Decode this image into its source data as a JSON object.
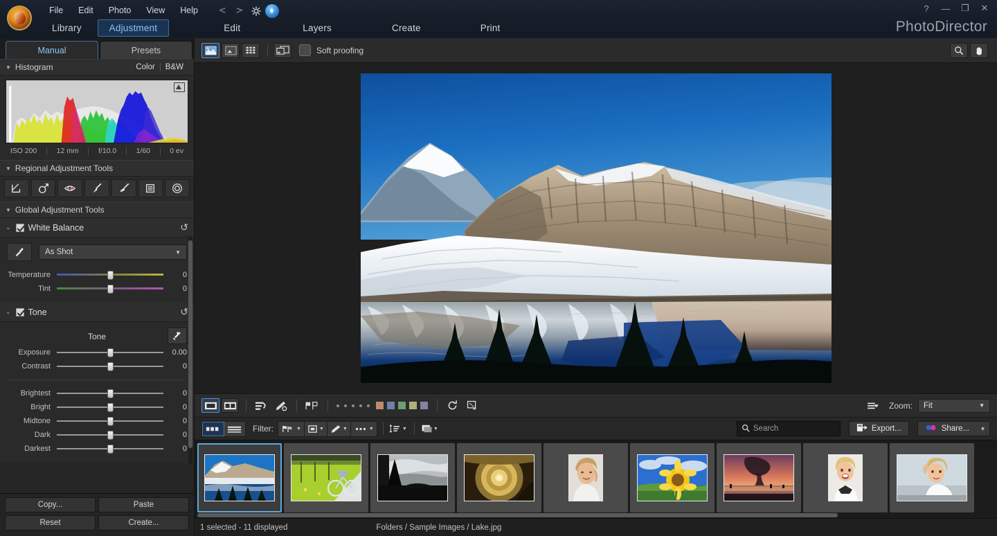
{
  "app": {
    "brand": "PhotoDirector",
    "menu": [
      "File",
      "Edit",
      "Photo",
      "View",
      "Help"
    ],
    "window_controls": {
      "help": "?",
      "minimize": "—",
      "restore": "❐",
      "close": "✕"
    },
    "icons": {
      "undo": "undo-arrow-icon",
      "redo": "redo-arrow-icon",
      "settings": "gear-icon",
      "notify": "bell-icon"
    }
  },
  "modebar": {
    "tabs": [
      {
        "id": "library",
        "label": "Library",
        "selected": false
      },
      {
        "id": "adjustment",
        "label": "Adjustment",
        "selected": true
      },
      {
        "id": "edit",
        "label": "Edit",
        "selected": false
      },
      {
        "id": "layers",
        "label": "Layers",
        "selected": false
      },
      {
        "id": "create",
        "label": "Create",
        "selected": false
      },
      {
        "id": "print",
        "label": "Print",
        "selected": false
      }
    ]
  },
  "left_panel": {
    "tabs": [
      {
        "label": "Manual",
        "selected": true
      },
      {
        "label": "Presets",
        "selected": false
      }
    ],
    "histogram": {
      "title": "Histogram",
      "color_label": "Color",
      "bw_label": "B&W",
      "exif": [
        "ISO 200",
        "12 mm",
        "f/10.0",
        "1/60",
        "0 ev"
      ]
    },
    "regional": {
      "title": "Regional Adjustment Tools",
      "tools": [
        "gradient-mask-icon",
        "adjustment-selection-icon",
        "red-eye-icon",
        "brush-icon",
        "clone-stamp-icon",
        "gradient-rect-icon",
        "radial-icon"
      ]
    },
    "global": {
      "title": "Global Adjustment Tools",
      "white_balance": {
        "title": "White Balance",
        "checked": true,
        "eyedropper": "eyedropper-icon",
        "preset_value": "As Shot",
        "sliders": [
          {
            "label": "Temperature",
            "value": "0",
            "pos": 50,
            "grad": "temp"
          },
          {
            "label": "Tint",
            "value": "0",
            "pos": 50,
            "grad": "tint"
          }
        ]
      },
      "tone": {
        "title": "Tone",
        "checked": true,
        "subtitle": "Tone",
        "auto_tone_icon": "magic-wand-icon",
        "sliders_top": [
          {
            "label": "Exposure",
            "value": "0.00",
            "pos": 50
          },
          {
            "label": "Contrast",
            "value": "0",
            "pos": 50
          }
        ],
        "sliders_bottom": [
          {
            "label": "Brightest",
            "value": "0",
            "pos": 50
          },
          {
            "label": "Bright",
            "value": "0",
            "pos": 50
          },
          {
            "label": "Midtone",
            "value": "0",
            "pos": 50
          },
          {
            "label": "Dark",
            "value": "0",
            "pos": 50
          },
          {
            "label": "Darkest",
            "value": "0",
            "pos": 50
          }
        ]
      }
    },
    "footer_buttons": [
      {
        "id": "copy",
        "label": "Copy..."
      },
      {
        "id": "paste",
        "label": "Paste"
      },
      {
        "id": "reset",
        "label": "Reset"
      },
      {
        "id": "create",
        "label": "Create..."
      }
    ]
  },
  "viewer_toolbar": {
    "view_modes": [
      {
        "id": "single",
        "icon": "single-view-icon",
        "selected": true
      },
      {
        "id": "compare",
        "icon": "compare-view-icon",
        "selected": false
      },
      {
        "id": "grid",
        "icon": "grid-view-icon",
        "selected": false
      }
    ],
    "before_after_icon": "before-after-icon",
    "soft_proofing": {
      "label": "Soft proofing",
      "checked": false
    },
    "zoom_tool_icon": "magnifier-icon",
    "pan_tool_icon": "hand-icon"
  },
  "bottom_toolbar": {
    "layout_modes": [
      {
        "id": "fill",
        "icon": "viewer-fill-icon",
        "selected": true
      },
      {
        "id": "split",
        "icon": "viewer-split-icon",
        "selected": false
      }
    ],
    "sort_icon": "sort-icon",
    "tag_icon": "tag-pencil-icon",
    "flag_icons": [
      "flag-pick-icon",
      "flag-reject-icon"
    ],
    "rating_dots": 5,
    "color_swatches": [
      "#c08a6e",
      "#6e7fa8",
      "#6e9d72",
      "#b0b078",
      "#8a7fa8"
    ],
    "rotate_icon": "rotate-icon",
    "crop_icon": "crop-icon",
    "list_options_icon": "list-options-icon",
    "zoom": {
      "label": "Zoom:",
      "value": "Fit"
    }
  },
  "filter_toolbar": {
    "view_toggle": [
      {
        "id": "thumbs",
        "icon": "thumb-strip-icon",
        "selected": true
      },
      {
        "id": "list",
        "icon": "list-rows-icon",
        "selected": false
      }
    ],
    "filter_label": "Filter:",
    "filter_buttons": [
      {
        "id": "flags",
        "icon": "flags-filter-icon"
      },
      {
        "id": "rating",
        "icon": "rating-filter-icon"
      },
      {
        "id": "tag",
        "icon": "tag-filter-icon"
      },
      {
        "id": "more",
        "icon": "more-filter-icon"
      }
    ],
    "sort_order_icon": "sort-order-icon",
    "stack_icon": "stack-icon",
    "search": {
      "placeholder": "Search",
      "value": "",
      "icon": "search-icon",
      "clear_icon": "close-icon"
    },
    "export_button": {
      "label": "Export...",
      "icon": "export-icon"
    },
    "share_button": {
      "label": "Share...",
      "icon": "share-dots-icon"
    }
  },
  "filmstrip": {
    "thumbnails": [
      {
        "id": "lake",
        "name": "Lake.jpg",
        "selected": true,
        "kind": "lake"
      },
      {
        "id": "bicycle",
        "name": "bicycle",
        "selected": false,
        "kind": "bicycle"
      },
      {
        "id": "bw-lake",
        "name": "bw-lake",
        "selected": false,
        "kind": "bw"
      },
      {
        "id": "spiral",
        "name": "spiral",
        "selected": false,
        "kind": "spiral"
      },
      {
        "id": "portrait1",
        "name": "portrait1",
        "selected": false,
        "kind": "portrait-a"
      },
      {
        "id": "sunflower",
        "name": "sunflower",
        "selected": false,
        "kind": "sunflower"
      },
      {
        "id": "sunset",
        "name": "sunset",
        "selected": false,
        "kind": "sunset"
      },
      {
        "id": "portrait2",
        "name": "portrait2",
        "selected": false,
        "kind": "portrait-b"
      },
      {
        "id": "portrait3",
        "name": "portrait3",
        "selected": false,
        "kind": "portrait-c"
      }
    ]
  },
  "statusbar": {
    "selection": "1 selected - 11 displayed",
    "path": "Folders / Sample Images / Lake.jpg"
  }
}
